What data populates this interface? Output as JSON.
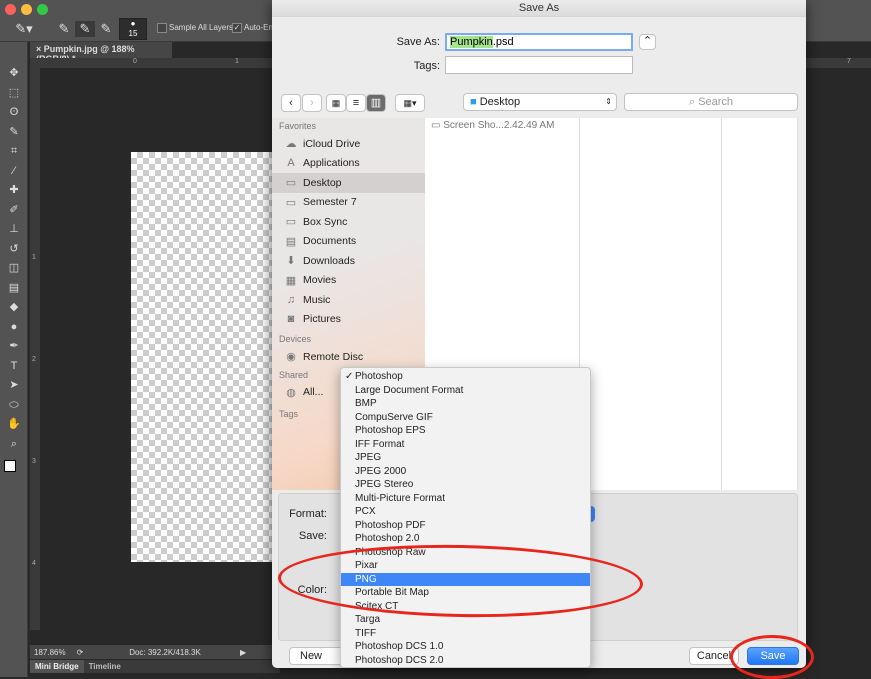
{
  "photoshop": {
    "options": {
      "brush_size": "15",
      "sample_all_layers": "Sample All Layers",
      "auto_enhance": "Auto-En"
    },
    "doc_tab": "Pumpkin.jpg @ 188% (RGB/8) *",
    "ruler_ticks": [
      "0",
      "1",
      "2",
      "3",
      "4",
      "5",
      "6",
      "7"
    ],
    "vruler_ticks": [
      "1",
      "2",
      "3",
      "4"
    ],
    "tools": [
      "move",
      "marquee",
      "lasso",
      "quick-select",
      "crop",
      "eyedropper",
      "healing",
      "brush",
      "stamp",
      "history-brush",
      "eraser",
      "gradient",
      "blur",
      "dodge",
      "pen",
      "type",
      "path-select",
      "shape",
      "hand",
      "zoom"
    ],
    "status": {
      "zoom": "187.86%",
      "doc": "Doc: 392.2K/418.3K"
    },
    "bottom_tabs": [
      "Mini Bridge",
      "Timeline"
    ]
  },
  "dialog": {
    "title": "Save As",
    "save_as_label": "Save As:",
    "filename_selected": "Pumpkin",
    "filename_ext": ".psd",
    "tags_label": "Tags:",
    "location": "Desktop",
    "search_placeholder": "Search",
    "sidebar": {
      "favorites_header": "Favorites",
      "favorites": [
        {
          "label": "iCloud Drive",
          "icon": "cloud-icon"
        },
        {
          "label": "Applications",
          "icon": "applications-icon"
        },
        {
          "label": "Desktop",
          "icon": "desktop-icon",
          "selected": true
        },
        {
          "label": "Semester 7",
          "icon": "folder-icon"
        },
        {
          "label": "Box Sync",
          "icon": "folder-icon"
        },
        {
          "label": "Documents",
          "icon": "documents-icon"
        },
        {
          "label": "Downloads",
          "icon": "downloads-icon"
        },
        {
          "label": "Movies",
          "icon": "movies-icon"
        },
        {
          "label": "Music",
          "icon": "music-icon"
        },
        {
          "label": "Pictures",
          "icon": "pictures-icon"
        }
      ],
      "devices_header": "Devices",
      "devices": [
        {
          "label": "Remote Disc",
          "icon": "disc-icon"
        }
      ],
      "shared_header": "Shared",
      "shared": [
        {
          "label": "All...",
          "icon": "network-icon"
        }
      ],
      "tags_header": "Tags"
    },
    "files": [
      "Screen Sho...2.42.49 AM"
    ],
    "format_label": "Format:",
    "save_label": "Save:",
    "color_label": "Color:",
    "format_options": [
      "Photoshop",
      "Large Document Format",
      "BMP",
      "CompuServe GIF",
      "Photoshop EPS",
      "IFF Format",
      "JPEG",
      "JPEG 2000",
      "JPEG Stereo",
      "Multi-Picture Format",
      "PCX",
      "Photoshop PDF",
      "Photoshop 2.0",
      "Photoshop Raw",
      "Pixar",
      "PNG",
      "Portable Bit Map",
      "Scitex CT",
      "Targa",
      "TIFF",
      "Photoshop DCS 1.0",
      "Photoshop DCS 2.0"
    ],
    "format_checked": "Photoshop",
    "format_highlighted": "PNG",
    "new_folder": "New Folder",
    "cancel": "Cancel",
    "save": "Save"
  },
  "colors": {
    "accent": "#3f86f6",
    "annotation": "#e8261c",
    "selection_text": "#a6e38d"
  }
}
